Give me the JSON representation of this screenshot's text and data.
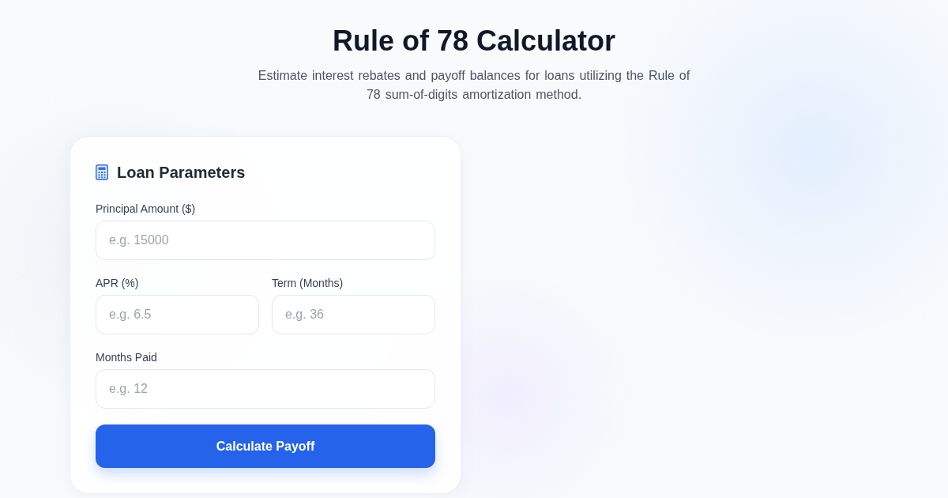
{
  "header": {
    "title": "Rule of 78 Calculator",
    "subtitle": "Estimate interest rebates and payoff balances for loans utilizing the Rule of 78 sum-of-digits amortization method."
  },
  "form": {
    "title": "Loan Parameters",
    "rows": [
      {
        "fields": [
          {
            "label": "Principal Amount ($)",
            "placeholder": "e.g. 15000"
          }
        ]
      },
      {
        "fields": [
          {
            "label": "APR (%)",
            "placeholder": "e.g. 6.5"
          },
          {
            "label": "Term (Months)",
            "placeholder": "e.g. 36"
          }
        ]
      },
      {
        "fields": [
          {
            "label": "Months Paid",
            "placeholder": "e.g. 12"
          }
        ]
      }
    ],
    "button": "Calculate Payoff"
  }
}
